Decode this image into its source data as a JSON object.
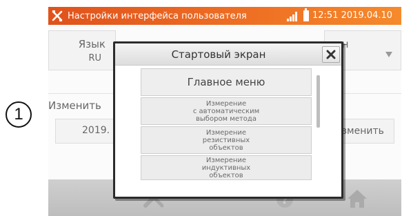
{
  "step_marker": "1",
  "statusbar": {
    "title": "Настройки интерфейса пользователя",
    "time": "12:51 2019.04.10",
    "logo_icon": "tools-logo-icon",
    "signal_icon": "signal-icon",
    "battery_icon": "battery-icon"
  },
  "background": {
    "language_label": "Язык",
    "language_value": "RU",
    "screen_label_partial": "ран",
    "screen_value_partial": "о",
    "change_label": "Изменить",
    "date_partial": "2019.",
    "change_button": "Изменить"
  },
  "modal": {
    "title": "Стартовый экран",
    "close_icon": "close-icon",
    "options": [
      "Главное меню",
      "Измерение\nс автоматическим\nвыбором метода",
      "Измерение\nрезистивных\nобъектов",
      "Измерение\nиндуктивных\nобъектов"
    ]
  },
  "bottombar": {
    "icons": [
      "tools-icon",
      "help-icon",
      "home-icon"
    ]
  },
  "colors": {
    "statusbar_start": "#e0521c",
    "statusbar_end": "#f58a2c",
    "bottombar": "#c6c6c6",
    "modal_border": "#2b2b2b"
  }
}
